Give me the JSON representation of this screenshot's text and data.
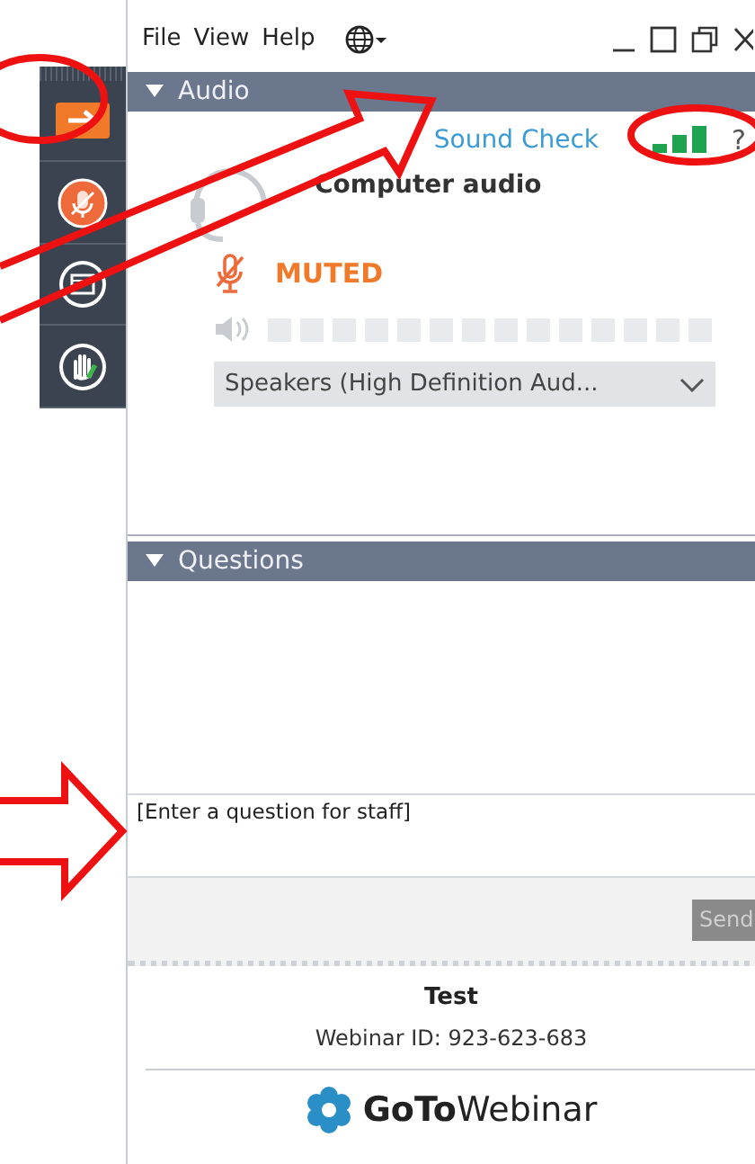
{
  "menu": [
    {
      "label": "File"
    },
    {
      "label": "View"
    },
    {
      "label": "Help"
    }
  ],
  "sidebar": [
    {
      "kind": "arrow"
    },
    {
      "kind": "mic"
    },
    {
      "kind": "screen"
    },
    {
      "kind": "hand"
    }
  ],
  "audio": {
    "title": "Audio",
    "sound_check": "Sound Check",
    "mode": "Computer audio",
    "muted": true,
    "mic_status": "MUTED",
    "help": "?",
    "speaker_select": "Speakers (High Definition Aud..."
  },
  "questions": {
    "title": "Questions",
    "placeholder": "[Enter a question for staff]",
    "send": "Send",
    "send_disabled": true
  },
  "footer": {
    "title": "Test",
    "webinar_id": "Webinar ID: 923-623-683",
    "brand": "**GoTo**Webinar"
  }
}
